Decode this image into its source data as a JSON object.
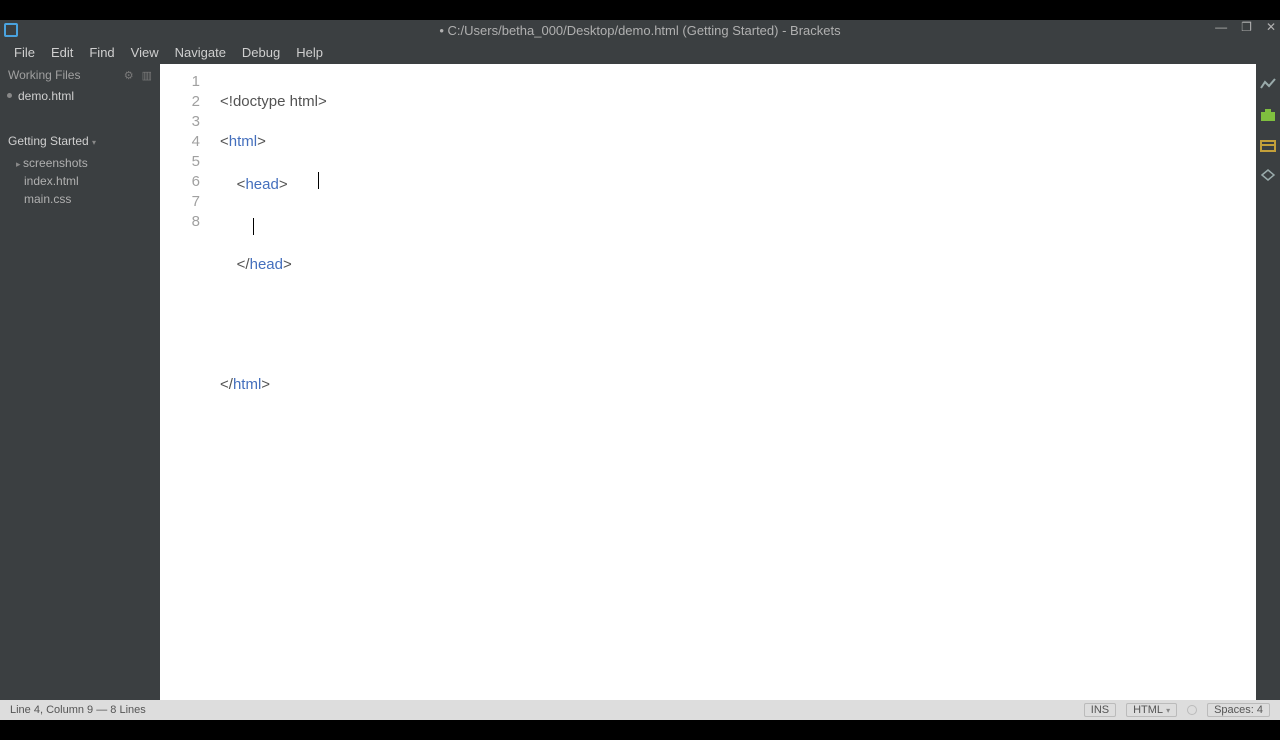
{
  "window": {
    "title": "• C:/Users/betha_000/Desktop/demo.html (Getting Started) - Brackets",
    "minimize": "—",
    "maximize": "❐",
    "close": "✕"
  },
  "menu": {
    "file": "File",
    "edit": "Edit",
    "find": "Find",
    "view": "View",
    "navigate": "Navigate",
    "debug": "Debug",
    "help": "Help"
  },
  "sidebar": {
    "working_files_label": "Working Files",
    "open_file": "demo.html",
    "project_label": "Getting Started ",
    "tree": {
      "folder": "screenshots",
      "file1": "index.html",
      "file2": "main.css"
    }
  },
  "editor": {
    "lines": [
      "1",
      "2",
      "3",
      "4",
      "5",
      "6",
      "7",
      "8"
    ],
    "code": {
      "l1_a": "<!",
      "l1_b": "doctype html",
      "l1_c": ">",
      "l2_a": "<",
      "l2_b": "html",
      "l2_c": ">",
      "l3_a": "    <",
      "l3_b": "head",
      "l3_c": ">",
      "l4": "        ",
      "l5_a": "    </",
      "l5_b": "head",
      "l5_c": ">",
      "l6": "",
      "l7": "",
      "l8_a": "</",
      "l8_b": "html",
      "l8_c": ">"
    }
  },
  "status": {
    "left": "Line 4, Column 9 — 8 Lines",
    "ins": "INS",
    "lang": "HTML",
    "spaces": "Spaces: 4"
  }
}
